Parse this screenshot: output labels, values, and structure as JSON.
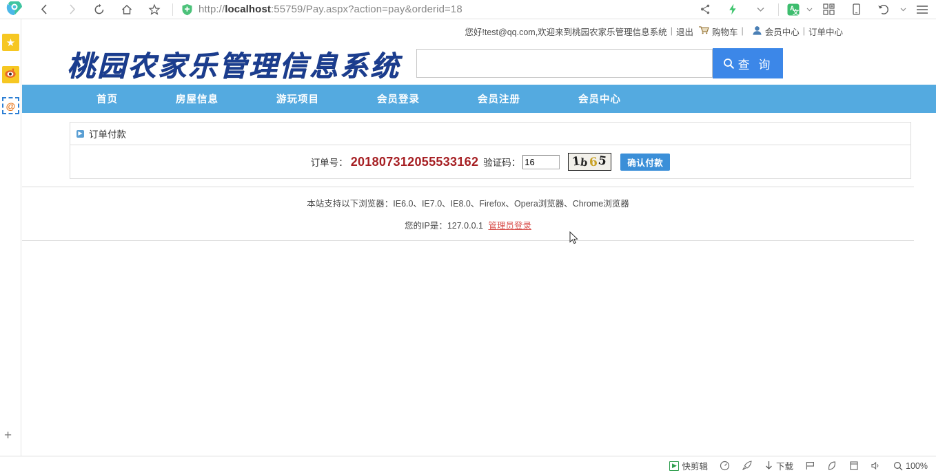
{
  "browser": {
    "url_prefix": "http://",
    "url_host": "localhost",
    "url_rest": ":55759/Pay.aspx?action=pay&orderid=18",
    "back_icon": "back-chevron-icon",
    "forward_icon": "forward-chevron-icon",
    "reload_icon": "reload-icon",
    "home_icon": "home-icon",
    "favorite_icon": "star-outline-icon",
    "shield_icon": "green-shield-icon",
    "share_icon": "share-icon",
    "lightning_icon": "lightning-icon",
    "chevron_icon": "chevron-down-icon",
    "translate_icon": "translate-icon",
    "apps_icon": "apps-grid-icon",
    "mobile_icon": "mobile-view-icon",
    "history_icon": "history-undo-icon",
    "menu_icon": "hamburger-menu-icon"
  },
  "sidebar": {
    "items": [
      {
        "name": "favorites",
        "glyph": "★"
      },
      {
        "name": "browse-eye",
        "glyph": "◉"
      },
      {
        "name": "mail-at",
        "glyph": "@"
      }
    ],
    "add_label": "+"
  },
  "topbar": {
    "greeting": "您好!test@qq.com,欢迎来到桃园农家乐管理信息系统",
    "logout": "退出",
    "cart": "购物车",
    "member_center": "会员中心",
    "order_center": "订单中心",
    "separator": "|"
  },
  "header": {
    "site_title": "桃园农家乐管理信息系统",
    "search_value": "",
    "search_placeholder": "",
    "search_button": "查 询",
    "search_icon": "search-magnifier-icon"
  },
  "nav": {
    "items": [
      {
        "label": "首页",
        "name": "nav-home"
      },
      {
        "label": "房屋信息",
        "name": "nav-house-info"
      },
      {
        "label": "游玩项目",
        "name": "nav-activities"
      },
      {
        "label": "会员登录",
        "name": "nav-member-login"
      },
      {
        "label": "会员注册",
        "name": "nav-member-register"
      },
      {
        "label": "会员中心",
        "name": "nav-member-center"
      }
    ]
  },
  "panel": {
    "title": "订单付款",
    "bullet_icon": "blue-square-bullet-icon",
    "order_label": "订单号：",
    "order_number": "201807312055533162",
    "captcha_label": "验证码：",
    "captcha_value": "16",
    "captcha_image_text": "1b65",
    "captcha_image_chars": [
      "1",
      "b",
      "6",
      "5"
    ],
    "pay_button": "确认付款"
  },
  "footer": {
    "browsers_line": "本站支持以下浏览器：IE6.0、IE7.0、IE8.0、Firefox、Opera浏览器、Chrome浏览器",
    "ip_line": "您的IP是：127.0.0.1",
    "admin_link": "管理员登录"
  },
  "statusbar": {
    "clip_tool": "快剪辑",
    "download": "下载",
    "zoom": "100%",
    "zoom_icon": "search-magnifier-icon",
    "items": [
      "clip-tool-icon",
      "speed-dial-icon",
      "rocket-icon",
      "download-icon",
      "flag-icon",
      "shield-scan-icon",
      "window-icon",
      "volume-icon"
    ]
  },
  "colors": {
    "nav_blue": "#54aae0",
    "button_blue": "#3c87e8",
    "pay_blue": "#3b8fd8",
    "order_red": "#a61f23",
    "admin_red": "#d9534f",
    "logo_blue": "#1b3d8f"
  }
}
